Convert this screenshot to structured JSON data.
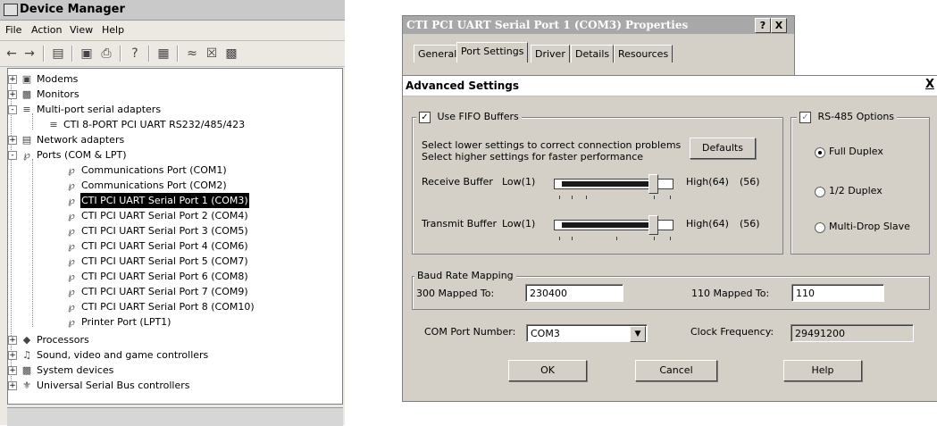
{
  "device_manager": {
    "title": "Device Manager",
    "menu": [
      "File",
      "Action",
      "View",
      "Help"
    ],
    "tree": [
      {
        "label": "Modems",
        "icon": "modem-icon",
        "expander": "+"
      },
      {
        "label": "Monitors",
        "icon": "monitor-icon",
        "expander": "+"
      },
      {
        "label": "Multi-port serial adapters",
        "icon": "serial-adapter-icon",
        "expander": "-"
      },
      {
        "label": "CTI 8-PORT PCI UART RS232/485/423",
        "icon": "serial-adapter-icon",
        "expander": ""
      },
      {
        "label": "Network adapters",
        "icon": "network-adapter-icon",
        "expander": "+"
      },
      {
        "label": "Ports (COM & LPT)",
        "icon": "port-icon",
        "expander": "-"
      },
      {
        "label": "Communications Port (COM1)",
        "icon": "port-icon",
        "expander": ""
      },
      {
        "label": "Communications Port (COM2)",
        "icon": "port-icon",
        "expander": ""
      },
      {
        "label": "CTI PCI UART Serial Port 1 (COM3)",
        "icon": "port-icon",
        "expander": "",
        "selected": true
      },
      {
        "label": "CTI PCI UART Serial Port 2 (COM4)",
        "icon": "port-icon",
        "expander": ""
      },
      {
        "label": "CTI PCI UART Serial Port 3 (COM5)",
        "icon": "port-icon",
        "expander": ""
      },
      {
        "label": "CTI PCI UART Serial Port 4 (COM6)",
        "icon": "port-icon",
        "expander": ""
      },
      {
        "label": "CTI PCI UART Serial Port 5 (COM7)",
        "icon": "port-icon",
        "expander": ""
      },
      {
        "label": "CTI PCI UART Serial Port 6 (COM8)",
        "icon": "port-icon",
        "expander": ""
      },
      {
        "label": "CTI PCI UART Serial Port 7 (COM9)",
        "icon": "port-icon",
        "expander": ""
      },
      {
        "label": "CTI PCI UART Serial Port 8 (COM10)",
        "icon": "port-icon",
        "expander": ""
      },
      {
        "label": "Printer Port (LPT1)",
        "icon": "port-icon",
        "expander": ""
      },
      {
        "label": "Processors",
        "icon": "processor-icon",
        "expander": "+"
      },
      {
        "label": "Sound, video and game controllers",
        "icon": "sound-icon",
        "expander": "+"
      },
      {
        "label": "System devices",
        "icon": "system-device-icon",
        "expander": "+"
      },
      {
        "label": "Universal Serial Bus controllers",
        "icon": "usb-icon",
        "expander": "+"
      }
    ]
  },
  "properties": {
    "title": "CTI PCI UART Serial Port 1 (COM3) Properties",
    "help_button": "?",
    "close_button": "X",
    "tabs": [
      "General",
      "Port Settings",
      "Driver",
      "Details",
      "Resources"
    ],
    "active_tab": "Port Settings"
  },
  "advanced": {
    "title": "Advanced Settings",
    "close_button": "X",
    "fifo": {
      "label": "Use FIFO Buffers",
      "checked": true,
      "hint1": "Select lower settings to correct connection problems",
      "hint2": "Select higher settings for faster performance",
      "defaults_button": "Defaults",
      "receive": {
        "label": "Receive Buffer",
        "low": "Low(1)",
        "high": "High(64)",
        "value_text": "(56)",
        "value": 56,
        "max": 64
      },
      "transmit": {
        "label": "Transmit Buffer",
        "low": "Low(1)",
        "high": "High(64)",
        "value_text": "(56)",
        "value": 56,
        "max": 64
      }
    },
    "rs485": {
      "label": "RS-485 Options",
      "checked": true,
      "options": [
        {
          "label": "Full Duplex",
          "selected": true
        },
        {
          "label": "1/2 Duplex",
          "selected": false
        },
        {
          "label": "Multi-Drop Slave",
          "selected": false
        }
      ]
    },
    "baud": {
      "label": "Baud Rate Mapping",
      "map300_label": "300 Mapped To:",
      "map300_value": "230400",
      "map110_label": "110 Mapped To:",
      "map110_value": "110"
    },
    "com_port_label": "COM Port Number:",
    "com_port_value": "COM3",
    "clock_label": "Clock Frequency:",
    "clock_value": "29491200",
    "buttons": {
      "ok": "OK",
      "cancel": "Cancel",
      "help": "Help"
    }
  }
}
